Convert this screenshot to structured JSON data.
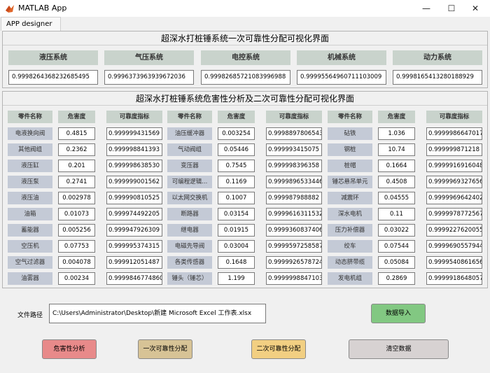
{
  "window": {
    "title": "MATLAB App",
    "minimize": "—",
    "maximize": "☐",
    "close": "✕"
  },
  "tab": "APP designer",
  "panel1": {
    "title": "超深水打桩锤系统一次可靠性分配可视化界面",
    "systems": [
      {
        "label": "液压系统",
        "value": "0.9998264368232685495"
      },
      {
        "label": "气压系统",
        "value": "0.99963739639396​72036"
      },
      {
        "label": "电控系统",
        "value": "0.9998268572108399​6988"
      },
      {
        "label": "机械系统",
        "value": "0.999955649607111​03009"
      },
      {
        "label": "动力系统",
        "value": "0.9998165413280188929"
      }
    ]
  },
  "panel2": {
    "title": "超深水打桩锤系统危害性分析及二次可靠性分配可视化界面",
    "headers": [
      "零件名称",
      "危害度",
      "可靠度指标",
      "零件名称",
      "危害度",
      "可靠度指标",
      "零件名称",
      "危害度",
      "可靠度指标"
    ],
    "rows": [
      [
        [
          "电液换向阀",
          "0.4815",
          "0.99999943156​9"
        ],
        [
          "油压缓冲器",
          "0.003254",
          "0.99988978​06543"
        ],
        [
          "砧铁",
          "1.036",
          "0.9999986647017"
        ]
      ],
      [
        [
          "其他阀组",
          "0.2362",
          "0.99999884139​3"
        ],
        [
          "气动阀组",
          "0.05446",
          "0.99999341507​5"
        ],
        [
          "钢桩",
          "10.74",
          "0.99999987121​8"
        ]
      ],
      [
        [
          "液压缸",
          "0.201",
          "0.99999863853​0"
        ],
        [
          "变压器",
          "0.7545",
          "0.99999839635​8"
        ],
        [
          "桩帽",
          "0.1664",
          "0.9999916916048"
        ]
      ],
      [
        [
          "液压泵",
          "0.2741",
          "0.99999900156​2"
        ],
        [
          "可编程逻辑...",
          "0.1169",
          "0.9999896533446"
        ],
        [
          "锤芯悬吊单元",
          "0.4508",
          "0.9999969327656"
        ]
      ],
      [
        [
          "液压油",
          "0.002978",
          "0.99999081052​5"
        ],
        [
          "以太网交换机",
          "0.1007",
          "0.99998798888​2"
        ],
        [
          "减震环",
          "0.04555",
          "0.9999969642402"
        ]
      ],
      [
        [
          "油箱",
          "0.01073",
          "0.9999744922​05"
        ],
        [
          "断路器",
          "0.03154",
          "0.9999616311532"
        ],
        [
          "深水电机",
          "0.11",
          "0.99999787725​67"
        ]
      ],
      [
        [
          "蓄能器",
          "0.005256",
          "0.9999479263​09"
        ],
        [
          "继电器",
          "0.01915",
          "0.9999360837406"
        ],
        [
          "压力补偿器",
          "0.03022",
          "0.9999227620055"
        ]
      ],
      [
        [
          "空压机",
          "0.07753",
          "0.99999537431​5"
        ],
        [
          "电磁先导阀",
          "0.03004",
          "0.9999597258587"
        ],
        [
          "绞车",
          "0.07544",
          "0.9999690557944"
        ]
      ],
      [
        [
          "空气过滤器",
          "0.004078",
          "0.99991205148​7"
        ],
        [
          "各类传感器",
          "0.1648",
          "0.9999926578724"
        ],
        [
          "动态脐带缆",
          "0.05084",
          "0.9999540861656"
        ]
      ],
      [
        [
          "油雾器",
          "0.00234",
          "0.99998467748​60"
        ],
        [
          "锤头（锤芯）",
          "1.199",
          "0.9999998847103"
        ],
        [
          "发电机组",
          "0.2869",
          "0.9999918648057"
        ]
      ]
    ]
  },
  "bottom": {
    "path_label": "文件路径",
    "path_value": "C:\\Users\\Administrator\\Desktop\\新建 Microsoft Excel 工作表.xlsx",
    "import_button": "数据导入",
    "hazard_button": "危害性分析",
    "first_button": "一次可靠性分配",
    "second_button": "二次可靠性分配",
    "clear_button": "清空数据"
  },
  "colors": {
    "import": "#82c882",
    "hazard": "#e88a8a",
    "first": "#d7c396",
    "second": "#f2cf82",
    "clear": "#d7d2d2",
    "header_bg": "#c9d3cc",
    "name_bg": "#c4cad6"
  }
}
